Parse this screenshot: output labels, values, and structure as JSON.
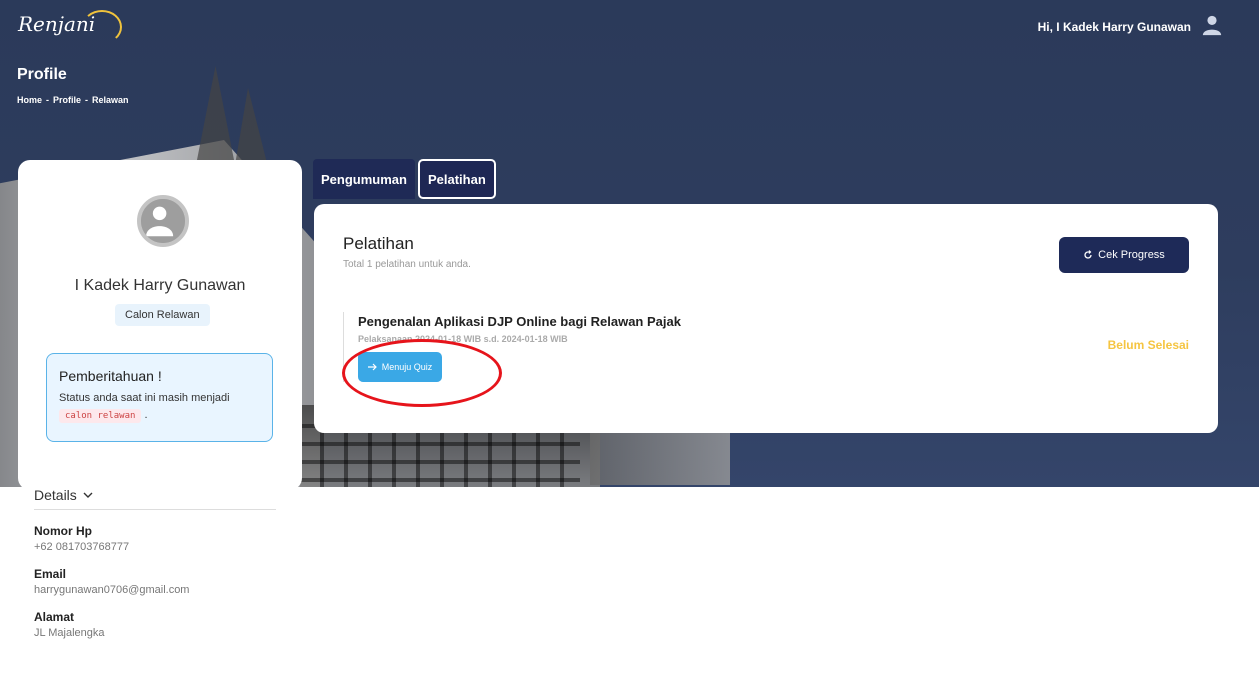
{
  "header": {
    "logo_text": "Renjani",
    "greeting": "Hi, I Kadek Harry Gunawan",
    "page_title": "Profile",
    "breadcrumb": [
      "Home",
      "-",
      "Profile",
      "-",
      "Relawan"
    ]
  },
  "profile": {
    "name": "I Kadek Harry Gunawan",
    "role": "Calon Relawan",
    "notice_title": "Pemberitahuan !",
    "notice_text": "Status anda saat ini masih menjadi",
    "notice_code": "calon relawan",
    "notice_end": "."
  },
  "details": {
    "heading": "Details",
    "items": [
      {
        "label": "Nomor Hp",
        "value": "+62 081703768777"
      },
      {
        "label": "Email",
        "value": "harrygunawan0706@gmail.com"
      },
      {
        "label": "Alamat",
        "value": "JL Majalengka"
      }
    ]
  },
  "tabs": [
    {
      "label": "Pengumuman",
      "active": false
    },
    {
      "label": "Pelatihan",
      "active": true
    }
  ],
  "main": {
    "title": "Pelatihan",
    "subtitle": "Total 1 pelatihan untuk anda.",
    "progress_button": "Cek Progress",
    "course": {
      "title": "Pengenalan Aplikasi DJP Online bagi Relawan Pajak",
      "date": "Pelaksanaan 2024-01-18 WIB s.d. 2024-01-18 WIB",
      "status": "Belum Selesai",
      "quiz_button": "Menuju Quiz"
    }
  },
  "colors": {
    "navy": "#1e2a58",
    "accent_blue": "#3aa8e6",
    "status_yellow": "#f5c542",
    "highlight_red": "#e6141b"
  },
  "icons": [
    "user-icon",
    "avatar-icon",
    "chevron-down-icon",
    "refresh-icon",
    "arrow-right-icon"
  ]
}
